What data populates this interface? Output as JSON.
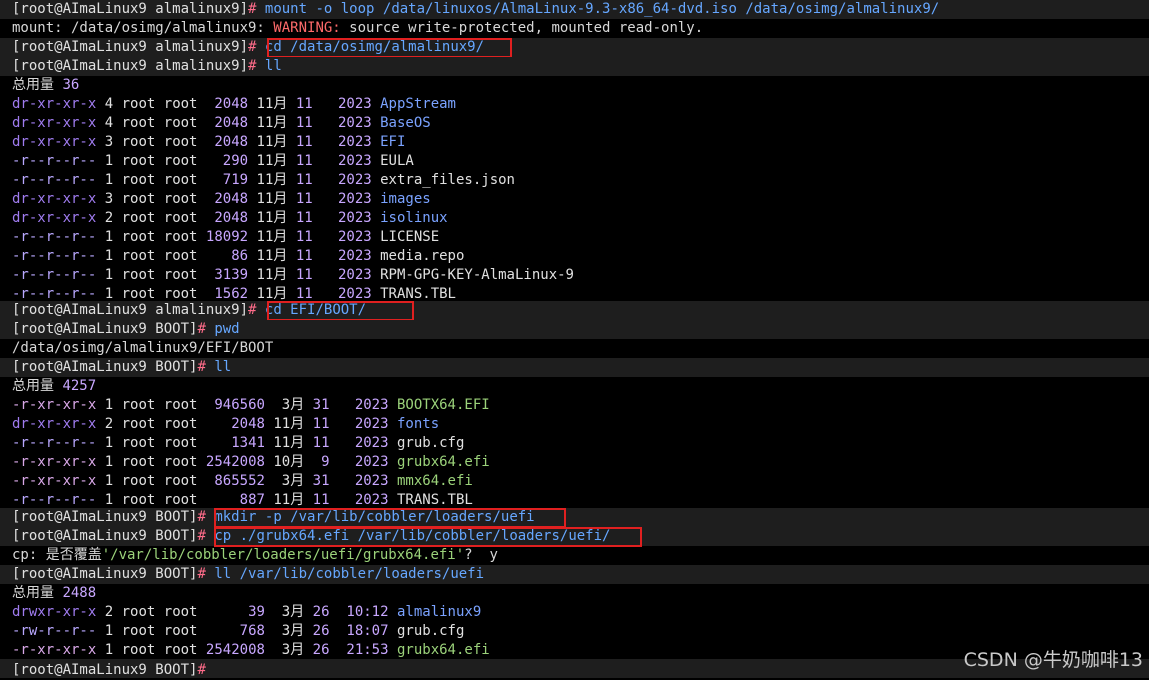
{
  "terminal": {
    "prompt_alma": "[root@AImaLinux9 almalinux9]",
    "prompt_boot": "[root@AImaLinux9 BOOT]",
    "hash": "#",
    "cmd_mount": "mount -o loop /data/linuxos/AlmaLinux-9.3-x86_64-dvd.iso /data/osimg/almalinux9/",
    "mount_prefix": "mount: /data/osimg/almalinux9: ",
    "mount_warning": "WARNING:",
    "mount_suffix": " source write-protected, mounted read-only.",
    "cmd_cd1": "cd /data/osimg/almalinux9/",
    "cmd_ll": "ll",
    "total_label": "总用量",
    "total1": "36",
    "listing1": [
      {
        "perm": "dr-xr-xr-x",
        "links": "4",
        "owner": "root",
        "group": "root",
        "size": "2048",
        "month": "11月",
        "day": "11",
        "time": "2023",
        "name": "AppStream"
      },
      {
        "perm": "dr-xr-xr-x",
        "links": "4",
        "owner": "root",
        "group": "root",
        "size": "2048",
        "month": "11月",
        "day": "11",
        "time": "2023",
        "name": "BaseOS"
      },
      {
        "perm": "dr-xr-xr-x",
        "links": "3",
        "owner": "root",
        "group": "root",
        "size": "2048",
        "month": "11月",
        "day": "11",
        "time": "2023",
        "name": "EFI"
      },
      {
        "perm": "-r--r--r--",
        "links": "1",
        "owner": "root",
        "group": "root",
        "size": "290",
        "month": "11月",
        "day": "11",
        "time": "2023",
        "name": "EULA"
      },
      {
        "perm": "-r--r--r--",
        "links": "1",
        "owner": "root",
        "group": "root",
        "size": "719",
        "month": "11月",
        "day": "11",
        "time": "2023",
        "name": "extra_files.json"
      },
      {
        "perm": "dr-xr-xr-x",
        "links": "3",
        "owner": "root",
        "group": "root",
        "size": "2048",
        "month": "11月",
        "day": "11",
        "time": "2023",
        "name": "images"
      },
      {
        "perm": "dr-xr-xr-x",
        "links": "2",
        "owner": "root",
        "group": "root",
        "size": "2048",
        "month": "11月",
        "day": "11",
        "time": "2023",
        "name": "isolinux"
      },
      {
        "perm": "-r--r--r--",
        "links": "1",
        "owner": "root",
        "group": "root",
        "size": "18092",
        "month": "11月",
        "day": "11",
        "time": "2023",
        "name": "LICENSE"
      },
      {
        "perm": "-r--r--r--",
        "links": "1",
        "owner": "root",
        "group": "root",
        "size": "86",
        "month": "11月",
        "day": "11",
        "time": "2023",
        "name": "media.repo"
      },
      {
        "perm": "-r--r--r--",
        "links": "1",
        "owner": "root",
        "group": "root",
        "size": "3139",
        "month": "11月",
        "day": "11",
        "time": "2023",
        "name": "RPM-GPG-KEY-AlmaLinux-9"
      },
      {
        "perm": "-r--r--r--",
        "links": "1",
        "owner": "root",
        "group": "root",
        "size": "1562",
        "month": "11月",
        "day": "11",
        "time": "2023",
        "name": "TRANS.TBL"
      }
    ],
    "cmd_cd2": "cd EFI/BOOT/",
    "cmd_pwd": "pwd",
    "pwd_output": "/data/osimg/almalinux9/EFI/BOOT",
    "total2": "4257",
    "listing2": [
      {
        "perm": "-r-xr-xr-x",
        "links": "1",
        "owner": "root",
        "group": "root",
        "size": "946560",
        "month": "3月",
        "day": "31",
        "time": "2023",
        "name": "BOOTX64.EFI"
      },
      {
        "perm": "dr-xr-xr-x",
        "links": "2",
        "owner": "root",
        "group": "root",
        "size": "2048",
        "month": "11月",
        "day": "11",
        "time": "2023",
        "name": "fonts"
      },
      {
        "perm": "-r--r--r--",
        "links": "1",
        "owner": "root",
        "group": "root",
        "size": "1341",
        "month": "11月",
        "day": "11",
        "time": "2023",
        "name": "grub.cfg"
      },
      {
        "perm": "-r-xr-xr-x",
        "links": "1",
        "owner": "root",
        "group": "root",
        "size": "2542008",
        "month": "10月",
        "day": "9",
        "time": "2023",
        "name": "grubx64.efi"
      },
      {
        "perm": "-r-xr-xr-x",
        "links": "1",
        "owner": "root",
        "group": "root",
        "size": "865552",
        "month": "3月",
        "day": "31",
        "time": "2023",
        "name": "mmx64.efi"
      },
      {
        "perm": "-r--r--r--",
        "links": "1",
        "owner": "root",
        "group": "root",
        "size": "887",
        "month": "11月",
        "day": "11",
        "time": "2023",
        "name": "TRANS.TBL"
      }
    ],
    "cmd_mkdir": "mkdir -p /var/lib/cobbler/loaders/uefi",
    "cmd_cp": "cp ./grubx64.efi /var/lib/cobbler/loaders/uefi/",
    "cp_prompt_prefix": "cp: 是否覆盖",
    "cp_prompt_path": "'/var/lib/cobbler/loaders/uefi/grubx64.efi'",
    "cp_prompt_suffix": "?  y",
    "cmd_ll3": "ll /var/lib/cobbler/loaders/uefi",
    "total3": "2488",
    "listing3": [
      {
        "perm": "drwxr-xr-x",
        "links": "2",
        "owner": "root",
        "group": "root",
        "size": "39",
        "month": "3月",
        "day": "26",
        "time": "10:12",
        "name": "almalinux9"
      },
      {
        "perm": "-rw-r--r--",
        "links": "1",
        "owner": "root",
        "group": "root",
        "size": "768",
        "month": "3月",
        "day": "26",
        "time": "18:07",
        "name": "grub.cfg"
      },
      {
        "perm": "-r-xr-xr-x",
        "links": "1",
        "owner": "root",
        "group": "root",
        "size": "2542008",
        "month": "3月",
        "day": "26",
        "time": "21:53",
        "name": "grubx64.efi"
      }
    ]
  },
  "watermark": "CSDN @牛奶咖啡13",
  "colors": {
    "background": "#000000",
    "prompt_band": "#1e1e1e",
    "highlight_box": "#e02020",
    "directory": "#7aa2ff",
    "executable": "#9bd27a",
    "number": "#c8a7ff",
    "warning": "#ff6b6b"
  }
}
